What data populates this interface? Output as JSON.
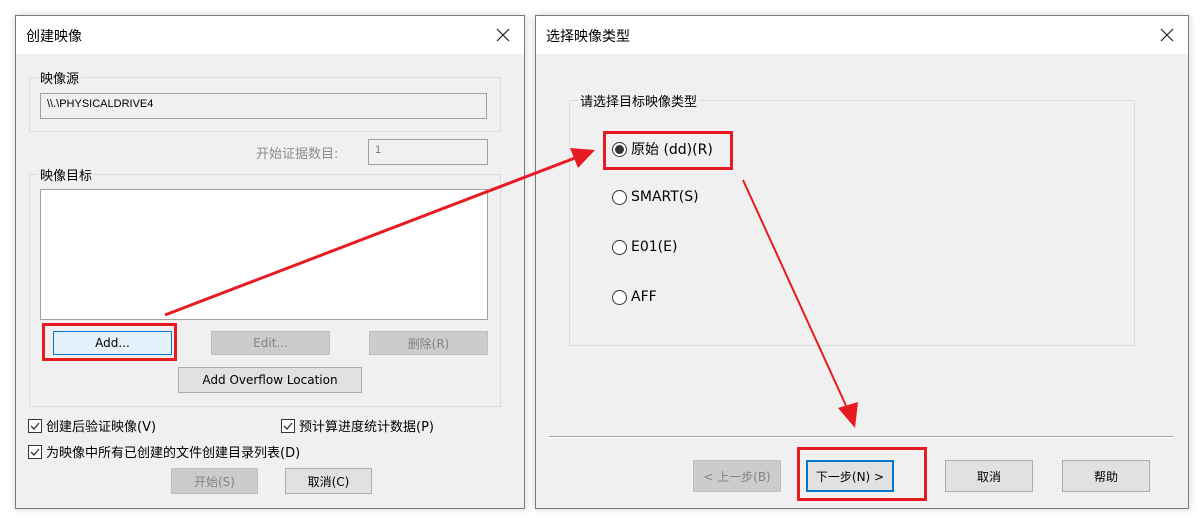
{
  "left_dialog": {
    "title": "创建映像",
    "close_icon": "close-icon",
    "source_group_label": "映像源",
    "source_value": "\\\\.\\PHYSICALDRIVE4",
    "start_evidence_label": "开始证据数目:",
    "start_evidence_value": "1",
    "target_group_label": "映像目标",
    "target_list_items": [],
    "add_button": "Add...",
    "edit_button": "Edit...",
    "delete_button": "删除(R)",
    "overflow_button": "Add Overflow Location",
    "checkboxes": [
      {
        "label": "创建后验证映像(V)",
        "checked": true
      },
      {
        "label": "预计算进度统计数据(P)",
        "checked": true
      },
      {
        "label": "为映像中所有已创建的文件创建目录列表(D)",
        "checked": true
      }
    ],
    "start_button": "开始(S)",
    "cancel_button": "取消(C)"
  },
  "right_dialog": {
    "title": "选择映像类型",
    "close_icon": "close-icon",
    "group_label": "请选择目标映像类型",
    "options": [
      {
        "label": "原始 (dd)(R)",
        "selected": true
      },
      {
        "label": "SMART(S)",
        "selected": false
      },
      {
        "label": "E01(E)",
        "selected": false
      },
      {
        "label": "AFF",
        "selected": false
      }
    ],
    "back_button": "< 上一步(B)",
    "next_button": "下一步(N) >",
    "cancel_button": "取消",
    "help_button": "帮助"
  },
  "annotations": {
    "highlight_color": "#e81b23"
  }
}
